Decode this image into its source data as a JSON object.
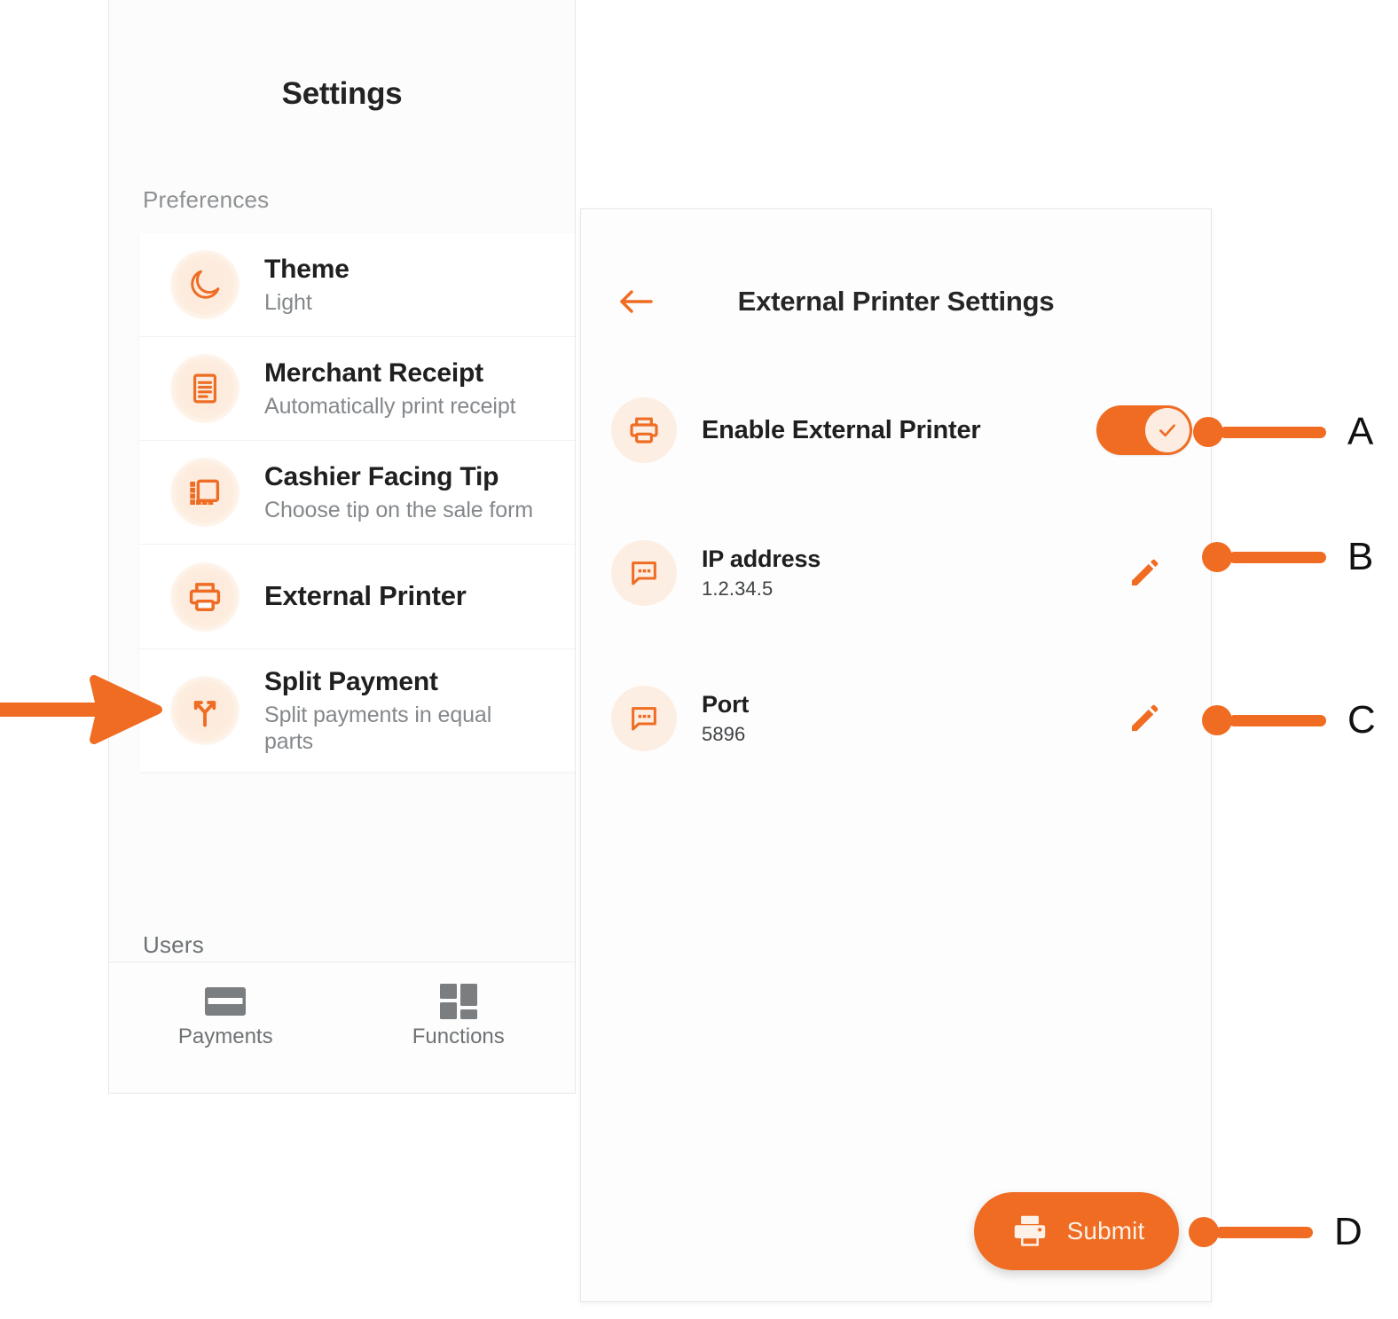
{
  "accent": "#EF6C22",
  "accent_soft": "#FDEEE3",
  "settings_panel": {
    "title": "Settings",
    "section_preferences": "Preferences",
    "section_users": "Users",
    "items": [
      {
        "icon": "moon-icon",
        "title": "Theme",
        "subtitle": "Light"
      },
      {
        "icon": "receipt-icon",
        "title": "Merchant Receipt",
        "subtitle": "Automatically print receipt"
      },
      {
        "icon": "tip-screen-icon",
        "title": "Cashier Facing Tip",
        "subtitle": "Choose tip on the sale form"
      },
      {
        "icon": "printer-icon",
        "title": "External Printer",
        "subtitle": ""
      },
      {
        "icon": "split-arrows-icon",
        "title": "Split Payment",
        "subtitle": "Split payments in equal parts"
      }
    ],
    "bottom_nav": [
      {
        "icon": "card-icon",
        "label": "Payments"
      },
      {
        "icon": "grid-icon",
        "label": "Functions"
      }
    ]
  },
  "printer_panel": {
    "back_icon": "arrow-left-icon",
    "title": "External Printer Settings",
    "enable_row": {
      "icon": "printer-icon",
      "label": "Enable External Printer",
      "toggle_state": "on",
      "toggle_glyph": "check-icon"
    },
    "fields": [
      {
        "icon": "message-dots-icon",
        "label": "IP address",
        "value": "1.2.34.5",
        "action_icon": "pencil-icon"
      },
      {
        "icon": "message-dots-icon",
        "label": "Port",
        "value": "5896",
        "action_icon": "pencil-icon"
      }
    ],
    "submit": {
      "icon": "printer-icon",
      "label": "Submit"
    }
  },
  "annotations": {
    "a": "A",
    "b": "B",
    "c": "C",
    "d": "D",
    "pointer": "arrow-right-icon"
  }
}
